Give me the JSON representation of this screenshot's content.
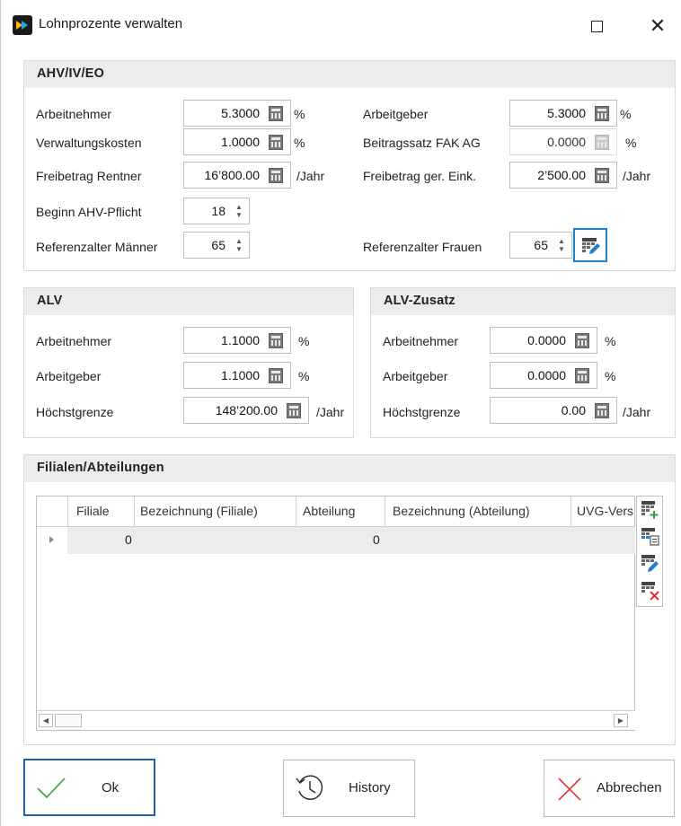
{
  "window": {
    "title": "Lohnprozente verwalten"
  },
  "ahv": {
    "heading": "AHV/IV/EO",
    "arbeitnehmer_label": "Arbeitnehmer",
    "arbeitnehmer_value": "5.3000",
    "arbeitnehmer_unit": "%",
    "arbeitgeber_label": "Arbeitgeber",
    "arbeitgeber_value": "5.3000",
    "arbeitgeber_unit": "%",
    "verwaltung_label": "Verwaltungskosten",
    "verwaltung_value": "1.0000",
    "verwaltung_unit": "%",
    "fak_label": "Beitragssatz FAK AG",
    "fak_value": "0.0000",
    "fak_unit": "%",
    "freibetrag_label": "Freibetrag Rentner",
    "freibetrag_value": "16’800.00",
    "freibetrag_unit": "/Jahr",
    "freibetrag_ger_label": "Freibetrag ger. Eink.",
    "freibetrag_ger_value": "2’500.00",
    "freibetrag_ger_unit": "/Jahr",
    "beginn_label": "Beginn AHV-Pflicht",
    "beginn_value": "18",
    "ref_m_label": "Referenzalter Männer",
    "ref_m_value": "65",
    "ref_f_label": "Referenzalter Frauen",
    "ref_f_value": "65"
  },
  "alv": {
    "heading": "ALV",
    "arbeitnehmer_label": "Arbeitnehmer",
    "arbeitnehmer_value": "1.1000",
    "arbeitnehmer_unit": "%",
    "arbeitgeber_label": "Arbeitgeber",
    "arbeitgeber_value": "1.1000",
    "arbeitgeber_unit": "%",
    "hoechst_label": "Höchstgrenze",
    "hoechst_value": "148’200.00",
    "hoechst_unit": "/Jahr"
  },
  "alv_zusatz": {
    "heading": "ALV-Zusatz",
    "arbeitnehmer_label": "Arbeitnehmer",
    "arbeitnehmer_value": "0.0000",
    "arbeitnehmer_unit": "%",
    "arbeitgeber_label": "Arbeitgeber",
    "arbeitgeber_value": "0.0000",
    "arbeitgeber_unit": "%",
    "hoechst_label": "Höchstgrenze",
    "hoechst_value": "0.00",
    "hoechst_unit": "/Jahr"
  },
  "filialen": {
    "heading": "Filialen/Abteilungen",
    "columns": [
      "Filiale",
      "Bezeichnung (Filiale)",
      "Abteilung",
      "Bezeichnung (Abteilung)",
      "UVG-Vers"
    ],
    "rows": [
      {
        "filiale": "0",
        "bezeichnung_filiale": "",
        "abteilung": "0",
        "bezeichnung_abteilung": "",
        "uvg": ""
      }
    ],
    "tools": [
      "add-row-icon",
      "copy-row-icon",
      "edit-row-icon",
      "delete-row-icon"
    ]
  },
  "buttons": {
    "ok": "Ok",
    "history": "History",
    "cancel": "Abbrechen"
  },
  "colors": {
    "focus_blue": "#1d7fd1",
    "ok_border": "#1d5fa8",
    "check_green": "#3c9a3c",
    "cancel_red": "#e03030",
    "header_grey": "#ececec"
  }
}
